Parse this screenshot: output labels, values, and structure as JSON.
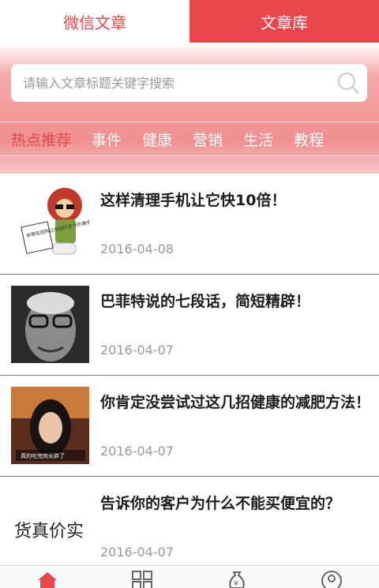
{
  "tabs": [
    {
      "label": "微信文章",
      "active": false
    },
    {
      "label": "文章库",
      "active": true
    }
  ],
  "search": {
    "placeholder": "请输入文章标题关键字搜索"
  },
  "categories": [
    "热点推荐",
    "事件",
    "健康",
    "营销",
    "生活",
    "教程"
  ],
  "articles": [
    {
      "title": "这样清理手机让它快10倍！",
      "date": "2016-04-08",
      "thumb_text": "有哪些厕所让你惊吓至今的事情"
    },
    {
      "title": "巴菲特说的七段话，简短精辟！",
      "date": "2016-04-07"
    },
    {
      "title": "你肯定没尝试过这几招健康的减肥方法！",
      "date": "2016-04-07",
      "thumb_text": "真的吃完肉长胖了"
    },
    {
      "title": "告诉你的客户为什么不能买便宜的？",
      "date": "2016-04-07",
      "thumb_text": "货真价实"
    }
  ],
  "bottom_nav": [
    {
      "icon": "home-icon"
    },
    {
      "icon": "grid-icon"
    },
    {
      "icon": "money-bag-icon"
    },
    {
      "icon": "user-icon"
    }
  ],
  "colors": {
    "accent": "#e8474c"
  }
}
